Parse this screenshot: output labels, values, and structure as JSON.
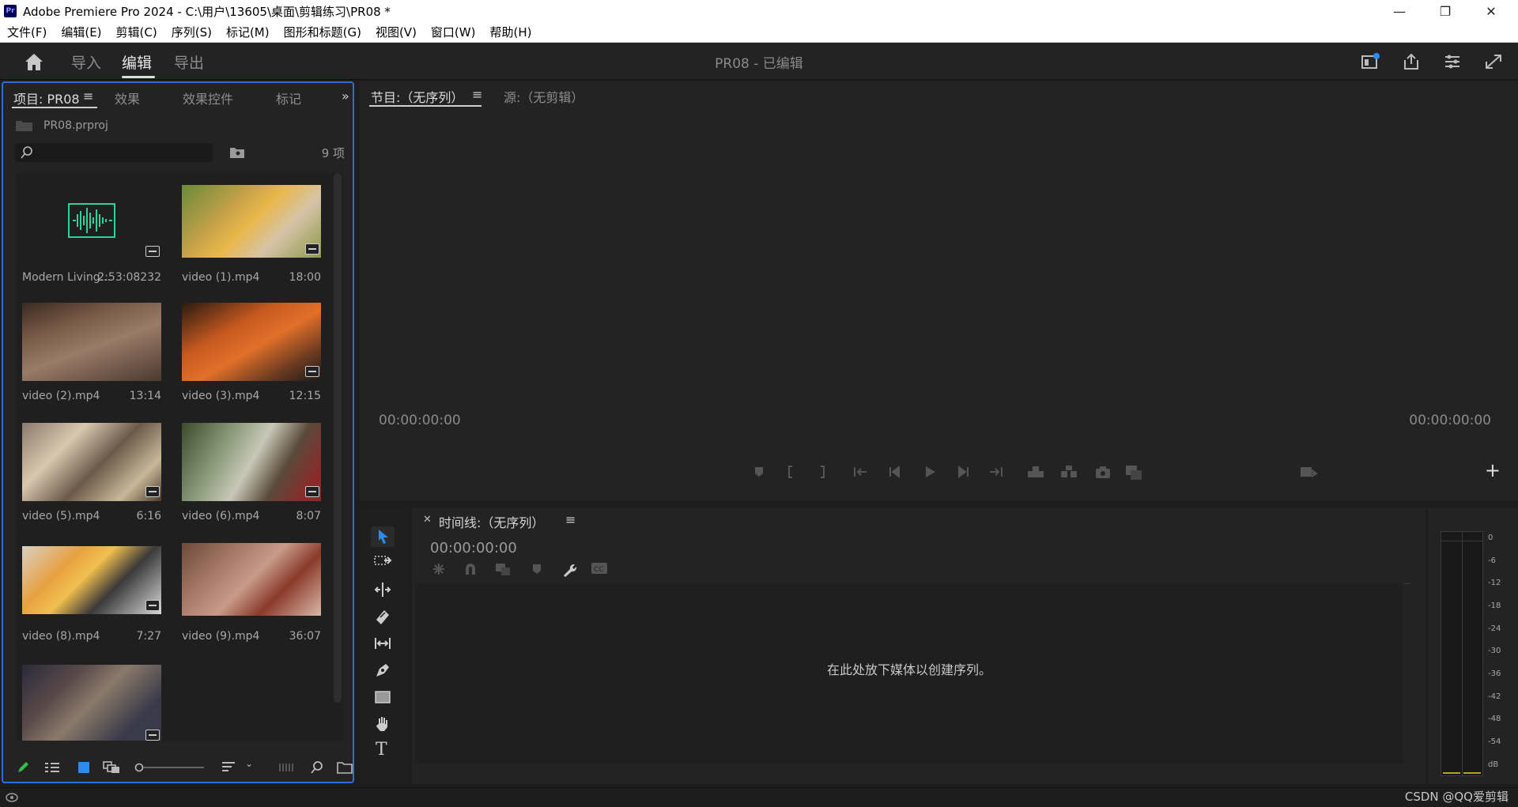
{
  "window": {
    "title": "Adobe Premiere Pro 2024 - C:\\用户\\13605\\桌面\\剪辑练习\\PR08 *",
    "app_icon": "Pr",
    "controls": [
      "minimize-icon",
      "restore-icon",
      "close-icon"
    ]
  },
  "menubar": {
    "items": [
      "文件(F)",
      "编辑(E)",
      "剪辑(C)",
      "序列(S)",
      "标记(M)",
      "图形和标题(G)",
      "视图(V)",
      "窗口(W)",
      "帮助(H)"
    ]
  },
  "header": {
    "tabs": [
      "导入",
      "编辑",
      "导出"
    ],
    "active_tab": "编辑",
    "project_title": "PR08 - 已编辑"
  },
  "project_panel": {
    "tabs": [
      "项目: PR08",
      "效果",
      "效果控件",
      "标记"
    ],
    "active_tab": "项目: PR08",
    "bin_name": "PR08.prproj",
    "item_count": "9 项",
    "search_value": "",
    "clips": [
      {
        "name": "Modern Living...",
        "duration": "2:53:08232",
        "type": "audio"
      },
      {
        "name": "video (1).mp4",
        "duration": "18:00",
        "type": "video"
      },
      {
        "name": "video (2).mp4",
        "duration": "13:14",
        "type": "video"
      },
      {
        "name": "video (3).mp4",
        "duration": "12:15",
        "type": "video"
      },
      {
        "name": "video (5).mp4",
        "duration": "6:16",
        "type": "video"
      },
      {
        "name": "video (6).mp4",
        "duration": "8:07",
        "type": "video"
      },
      {
        "name": "video (8).mp4",
        "duration": "7:27",
        "type": "video"
      },
      {
        "name": "video (9).mp4",
        "duration": "36:07",
        "type": "video"
      },
      {
        "name": "",
        "duration": "",
        "type": "video"
      }
    ]
  },
  "program_monitor": {
    "tabs": [
      "节目:（无序列）",
      "源:（无剪辑）"
    ],
    "active_tab": "节目:（无序列）",
    "timecode_left": "00:00:00:00",
    "timecode_right": "00:00:00:00"
  },
  "timeline": {
    "title": "时间线:（无序列）",
    "timecode": "00:00:00:00",
    "empty_message": "在此处放下媒体以创建序列。"
  },
  "audio_meter": {
    "scale": [
      "0",
      "-6",
      "-12",
      "-18",
      "-24",
      "-30",
      "-36",
      "-42",
      "-48",
      "-54",
      "dB"
    ]
  },
  "watermark": "CSDN @QQ爱剪辑",
  "colors": {
    "accent_blue": "#2d6fd6",
    "audio_green": "#2fd29a",
    "panel_bg": "#232323"
  }
}
